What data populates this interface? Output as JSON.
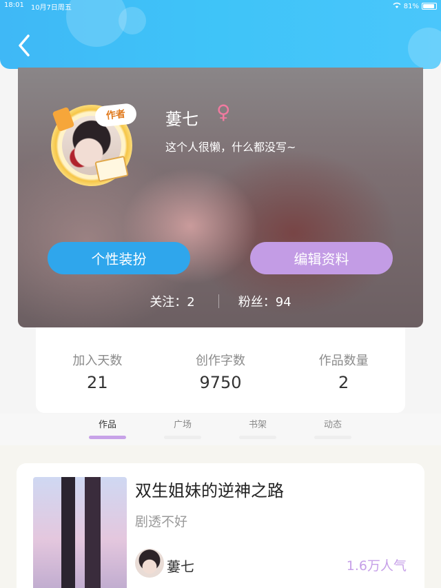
{
  "status_bar": {
    "time": "18:01",
    "date": "10月7日周五",
    "battery": "81%"
  },
  "header": {
    "back_icon": "chevron-left-icon"
  },
  "profile": {
    "badge": "作者",
    "name": "蔞七",
    "gender_symbol": "♀",
    "bio": "这个人很懒，什么都没写~",
    "buttons": {
      "decorate": "个性装扮",
      "edit": "编辑资料"
    },
    "following": "关注：2",
    "followers": "粉丝：94"
  },
  "stats": [
    {
      "label": "加入天数",
      "value": "21"
    },
    {
      "label": "创作字数",
      "value": "9750"
    },
    {
      "label": "作品数量",
      "value": "2"
    }
  ],
  "tabs": [
    {
      "label": "作品",
      "active": true
    },
    {
      "label": "广场",
      "active": false
    },
    {
      "label": "书架",
      "active": false
    },
    {
      "label": "动态",
      "active": false
    }
  ],
  "work": {
    "title": "双生姐妹的逆神之路",
    "tag": "剧透不好",
    "author": "蔞七",
    "popularity": "1.6万人气"
  },
  "colors": {
    "header": "#3fc4f8",
    "decorate_button": "#2fa6ec",
    "edit_button": "#c39ce5",
    "active_tab": "#c7a2e8"
  }
}
